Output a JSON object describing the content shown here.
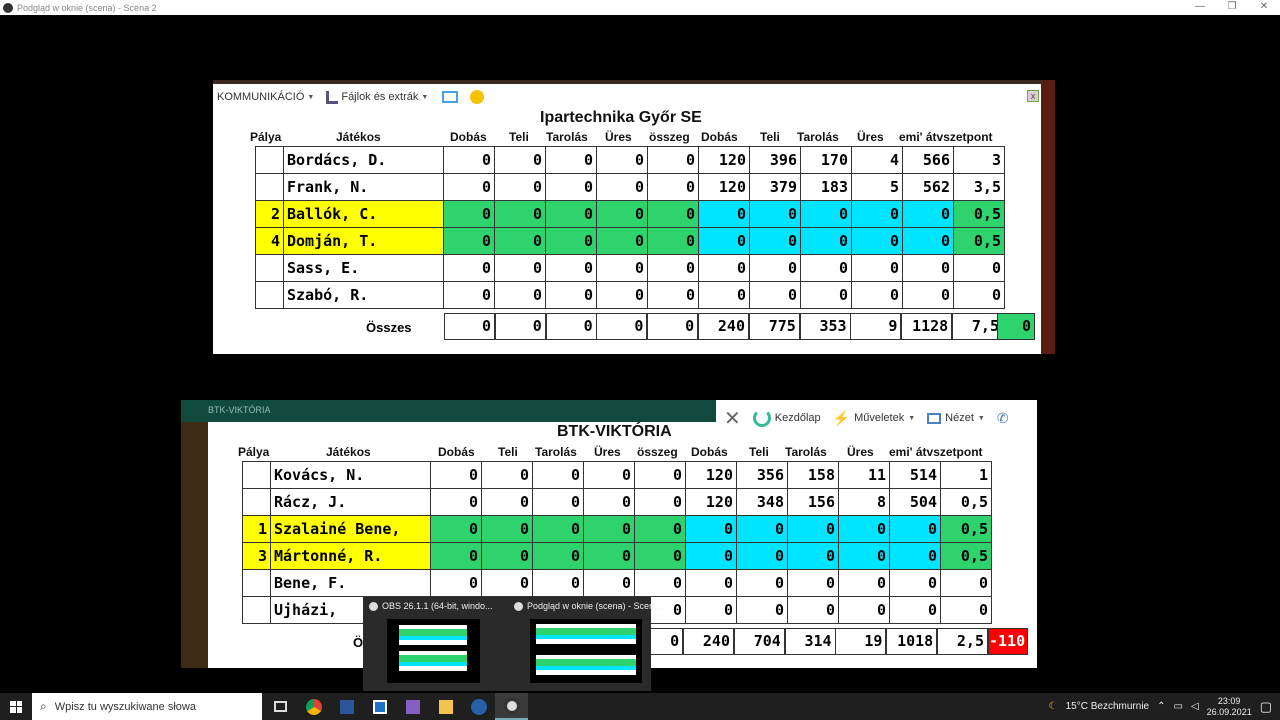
{
  "window": {
    "title": "Podgląd w oknie (scena) - Scena 2",
    "minimize": "—",
    "restore": "❐",
    "close": "✕"
  },
  "panel1": {
    "toolbar": {
      "menu1": "KOMMUNIKÁCIÓ",
      "menu2": "Fájlok és extrák",
      "close": "x"
    },
    "team": "Ipartechnika Győr SE",
    "headers": [
      "Pálya",
      "Játékos",
      "Dobás",
      "Teli",
      "Tarolás",
      "Üres",
      "összeg",
      "Dobás",
      "Teli",
      "Tarolás",
      "Üres",
      "emi' átvszetpont"
    ],
    "rows": [
      {
        "pos": "",
        "name": "Bordács, D.",
        "v": [
          "0",
          "0",
          "0",
          "0",
          "0",
          "120",
          "396",
          "170",
          "4",
          "566",
          "3"
        ],
        "hl": false
      },
      {
        "pos": "",
        "name": "Frank, N.",
        "v": [
          "0",
          "0",
          "0",
          "0",
          "0",
          "120",
          "379",
          "183",
          "5",
          "562",
          "3,5"
        ],
        "hl": false
      },
      {
        "pos": "2",
        "name": "Ballók, C.",
        "v": [
          "0",
          "0",
          "0",
          "0",
          "0",
          "0",
          "0",
          "0",
          "0",
          "0",
          "0,5"
        ],
        "hl": true
      },
      {
        "pos": "4",
        "name": "Domján, T.",
        "v": [
          "0",
          "0",
          "0",
          "0",
          "0",
          "0",
          "0",
          "0",
          "0",
          "0",
          "0,5"
        ],
        "hl": true
      },
      {
        "pos": "",
        "name": "Sass, E.",
        "v": [
          "0",
          "0",
          "0",
          "0",
          "0",
          "0",
          "0",
          "0",
          "0",
          "0",
          "0"
        ],
        "hl": false
      },
      {
        "pos": "",
        "name": "Szabó, R.",
        "v": [
          "0",
          "0",
          "0",
          "0",
          "0",
          "0",
          "0",
          "0",
          "0",
          "0",
          "0"
        ],
        "hl": false
      }
    ],
    "total_label": "Összes",
    "totals": [
      "0",
      "0",
      "0",
      "0",
      "0",
      "240",
      "775",
      "353",
      "9",
      "1128",
      "7,5"
    ],
    "result": "0"
  },
  "panel2": {
    "banner": "BTK-VIKTÓRIA",
    "toolbar": {
      "home": "Kezdőlap",
      "ops": "Műveletek",
      "view": "Nézet"
    },
    "team": "BTK-VIKTÓRIA",
    "headers": [
      "Pálya",
      "Játékos",
      "Dobás",
      "Teli",
      "Tarolás",
      "Üres",
      "összeg",
      "Dobás",
      "Teli",
      "Tarolás",
      "Üres",
      "emi' átvszetpont"
    ],
    "rows": [
      {
        "pos": "",
        "name": "Kovács, N.",
        "v": [
          "0",
          "0",
          "0",
          "0",
          "0",
          "120",
          "356",
          "158",
          "11",
          "514",
          "1"
        ],
        "hl": false
      },
      {
        "pos": "",
        "name": "Rácz, J.",
        "v": [
          "0",
          "0",
          "0",
          "0",
          "0",
          "120",
          "348",
          "156",
          "8",
          "504",
          "0,5"
        ],
        "hl": false
      },
      {
        "pos": "1",
        "name": "Szalainé Bene,",
        "v": [
          "0",
          "0",
          "0",
          "0",
          "0",
          "0",
          "0",
          "0",
          "0",
          "0",
          "0,5"
        ],
        "hl": true
      },
      {
        "pos": "3",
        "name": "Mártonné, R.",
        "v": [
          "0",
          "0",
          "0",
          "0",
          "0",
          "0",
          "0",
          "0",
          "0",
          "0",
          "0,5"
        ],
        "hl": true
      },
      {
        "pos": "",
        "name": "Bene, F.",
        "v": [
          "0",
          "0",
          "0",
          "0",
          "0",
          "0",
          "0",
          "0",
          "0",
          "0",
          "0"
        ],
        "hl": false
      },
      {
        "pos": "",
        "name": "Ujházi,",
        "v": [
          "0",
          "0",
          "0",
          "0",
          "0",
          "0",
          "0",
          "0",
          "0",
          "0",
          "0"
        ],
        "hl": false
      }
    ],
    "total_label": "Ö",
    "totals": [
      "0",
      "240",
      "704",
      "314",
      "19",
      "1018",
      "2,5"
    ],
    "result": "-110"
  },
  "thumbs": [
    {
      "title": "OBS 26.1.1 (64-bit, windo..."
    },
    {
      "title": "Podgląd w oknie (scena) - Scen..."
    }
  ],
  "taskbar": {
    "search_placeholder": "Wpisz tu wyszukiwane słowa",
    "weather": "15°C Bezchmurnie",
    "time": "23:09",
    "date": "26.09.2021"
  },
  "colors": {
    "yellow": "#ffff00",
    "green": "#2ed36e",
    "cyan": "#00e5ff",
    "red": "#ff0000"
  }
}
